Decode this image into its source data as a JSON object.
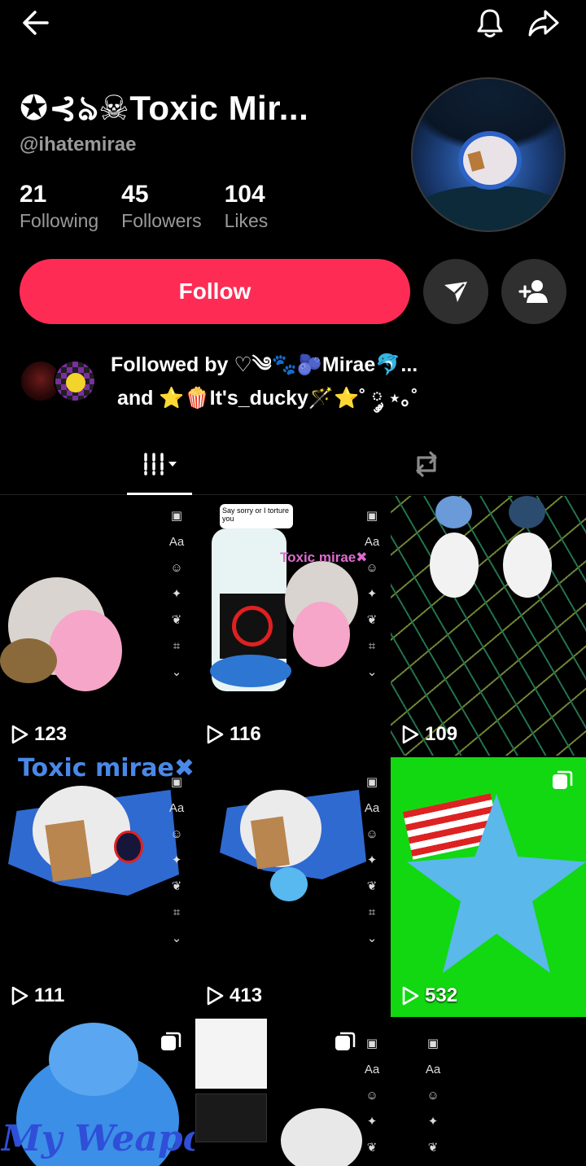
{
  "header": {
    "back_icon": "arrow-left-icon",
    "bell_icon": "bell-icon",
    "share_icon": "share-arrow-icon"
  },
  "profile": {
    "display_name": "✪⊰ঌ☠Toxic Mir...",
    "username": "@ihatemirae",
    "stats": [
      {
        "value": "21",
        "label": "Following"
      },
      {
        "value": "45",
        "label": "Followers"
      },
      {
        "value": "104",
        "label": "Likes"
      }
    ],
    "follow_label": "Follow",
    "followed_by_line1": "Followed by ♡༄🐾🫐Mirae🐬...",
    "followed_by_line2": "and ⭐🍿It's_ducky🪄⭐˚ ༘ ⋆｡˚"
  },
  "tabs": {
    "active": "videos-tab",
    "items": [
      "videos",
      "reposts"
    ]
  },
  "videos": [
    {
      "views": "123",
      "overlay": ""
    },
    {
      "views": "116",
      "overlay": "Toxic mirae✖"
    },
    {
      "views": "109",
      "overlay": ""
    },
    {
      "views": "111",
      "overlay": "Toxic mirae✖"
    },
    {
      "views": "413",
      "overlay": ""
    },
    {
      "views": "532",
      "overlay": ""
    },
    {
      "views": "",
      "overlay": "My Weapon"
    },
    {
      "views": "",
      "overlay": ""
    },
    {
      "views": "",
      "overlay": ""
    }
  ],
  "editor_tools": [
    "Aa"
  ],
  "colors": {
    "accent": "#fe2c55",
    "background": "#000000",
    "secondary_text": "#9a9a9a",
    "button_dark": "#2f2f2f"
  }
}
